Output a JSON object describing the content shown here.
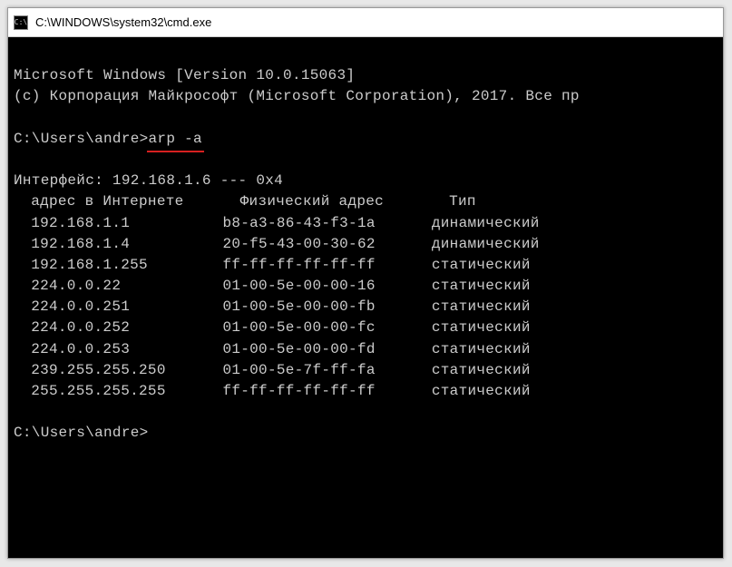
{
  "titlebar": {
    "icon_label": "C:\\",
    "title": "C:\\WINDOWS\\system32\\cmd.exe"
  },
  "banner": {
    "line1": "Microsoft Windows [Version 10.0.15063]",
    "line2": "(с) Корпорация Майкрософт (Microsoft Corporation), 2017. Все пр"
  },
  "prompt1": {
    "path": "C:\\Users\\andre>",
    "command": "arp -a"
  },
  "interface_line": "Интерфейс: 192.168.1.6 --- 0x4",
  "table": {
    "headers": {
      "ip": "адрес в Интернете",
      "mac": "Физический адрес",
      "type": "Тип"
    },
    "rows": [
      {
        "ip": "192.168.1.1",
        "mac": "b8-a3-86-43-f3-1a",
        "type": "динамический"
      },
      {
        "ip": "192.168.1.4",
        "mac": "20-f5-43-00-30-62",
        "type": "динамический"
      },
      {
        "ip": "192.168.1.255",
        "mac": "ff-ff-ff-ff-ff-ff",
        "type": "статический"
      },
      {
        "ip": "224.0.0.22",
        "mac": "01-00-5e-00-00-16",
        "type": "статический"
      },
      {
        "ip": "224.0.0.251",
        "mac": "01-00-5e-00-00-fb",
        "type": "статический"
      },
      {
        "ip": "224.0.0.252",
        "mac": "01-00-5e-00-00-fc",
        "type": "статический"
      },
      {
        "ip": "224.0.0.253",
        "mac": "01-00-5e-00-00-fd",
        "type": "статический"
      },
      {
        "ip": "239.255.255.250",
        "mac": "01-00-5e-7f-ff-fa",
        "type": "статический"
      },
      {
        "ip": "255.255.255.255",
        "mac": "ff-ff-ff-ff-ff-ff",
        "type": "статический"
      }
    ]
  },
  "prompt2": {
    "path": "C:\\Users\\andre>"
  }
}
